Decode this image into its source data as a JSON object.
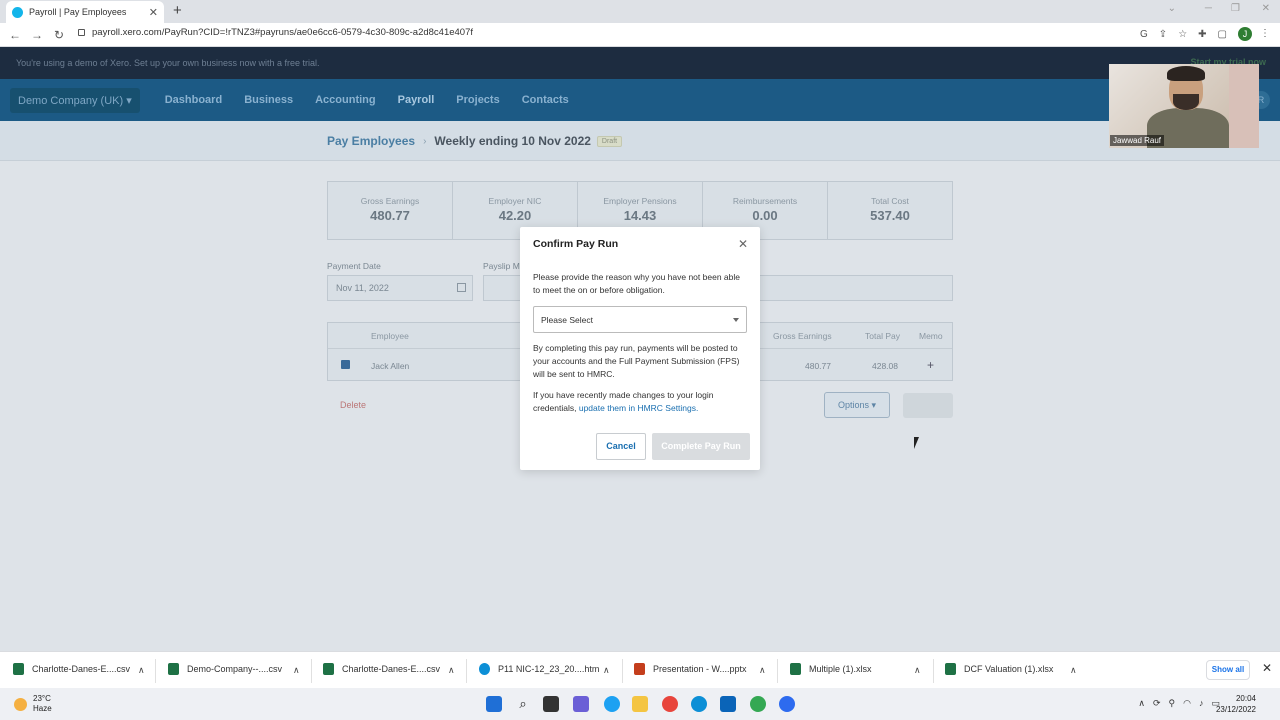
{
  "browser": {
    "tab_title": "Payroll | Pay Employees",
    "url": "payroll.xero.com/PayRun?CID=!rTNZ3#payruns/ae0e6cc6-0579-4c30-809c-a2d8c41e407f",
    "profile_initial": "J"
  },
  "xero": {
    "banner_text": "You're using a demo of Xero. Set up your own business now with a free trial.",
    "banner_cta": "Start my trial now",
    "org_name": "Demo Company (UK)",
    "nav": [
      "Dashboard",
      "Business",
      "Accounting",
      "Payroll",
      "Projects",
      "Contacts"
    ],
    "user_initials": "R",
    "breadcrumb": {
      "parent": "Pay Employees",
      "current": "Weekly ending 10 Nov 2022",
      "status": "Draft"
    },
    "summary": [
      {
        "label": "Gross Earnings",
        "value": "480.77"
      },
      {
        "label": "Employer NIC",
        "value": "42.20"
      },
      {
        "label": "Employer Pensions",
        "value": "14.43"
      },
      {
        "label": "Reimbursements",
        "value": "0.00"
      },
      {
        "label": "Total Cost",
        "value": "537.40"
      }
    ],
    "payment_date_label": "Payment Date",
    "payment_date_value": "Nov 11, 2022",
    "payslip_label": "Payslip M",
    "table": {
      "headers": {
        "employee": "Employee",
        "gross": "Gross Earnings",
        "total_pay": "Total Pay",
        "memo": "Memo"
      },
      "rows": [
        {
          "employee": "Jack Allen",
          "gross": "480.77",
          "total_pay": "428.08"
        }
      ]
    },
    "delete_label": "Delete",
    "options_label": "Options"
  },
  "modal": {
    "title": "Confirm Pay Run",
    "reason_text": "Please provide the reason why you have not been able to meet the on or before obligation.",
    "select_value": "Please Select",
    "fps_text": "By completing this pay run, payments will be posted to your accounts and the Full Payment Submission (FPS) will be sent to HMRC.",
    "credentials_text": "If you have recently made changes to your login credentials,",
    "credentials_link": "update them in HMRC Settings.",
    "cancel_label": "Cancel",
    "complete_label": "Complete Pay Run"
  },
  "webcam": {
    "name": "Jawwad Rauf"
  },
  "downloads": [
    {
      "name": "Charlotte-Danes-E....csv",
      "icon": "excel-icon",
      "color": "#1e7145"
    },
    {
      "name": "Demo-Company--....csv",
      "icon": "excel-icon",
      "color": "#1e7145"
    },
    {
      "name": "Charlotte-Danes-E....csv",
      "icon": "excel-icon",
      "color": "#1e7145"
    },
    {
      "name": "P11 NIC-12_23_20....htm",
      "icon": "edge-icon",
      "color": "#0c8fd6"
    },
    {
      "name": "Presentation - W....pptx",
      "icon": "powerpoint-icon",
      "color": "#c43e1c"
    },
    {
      "name": "Multiple (1).xlsx",
      "icon": "excel-icon",
      "color": "#1e7145"
    },
    {
      "name": "DCF Valuation (1).xlsx",
      "icon": "excel-icon",
      "color": "#1e7145"
    }
  ],
  "show_all_label": "Show all",
  "taskbar": {
    "temperature": "23°C",
    "weather": "Haze",
    "time": "20:04",
    "date": "23/12/2022"
  }
}
